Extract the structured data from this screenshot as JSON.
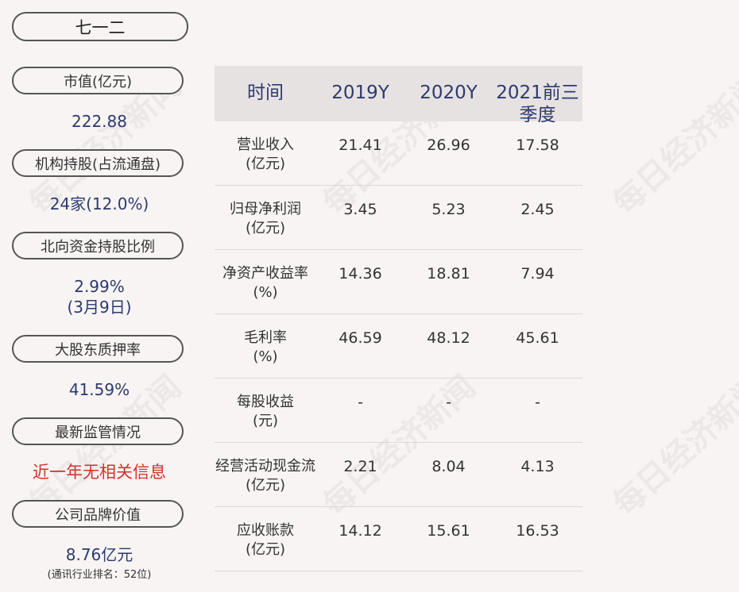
{
  "company": "七一二",
  "left_panel": [
    {
      "label": "市值(亿元)",
      "value": "222.88"
    },
    {
      "label": "机构持股(占流通盘)",
      "value": "24家(12.0%)"
    },
    {
      "label": "北向资金持股比例",
      "value": "2.99%",
      "value2": "(3月9日)"
    },
    {
      "label": "大股东质押率",
      "value": "41.59%"
    },
    {
      "label": "最新监管情况",
      "value": "近一年无相关信息"
    },
    {
      "label": "公司品牌价值",
      "value": "8.76亿元",
      "note": "(通讯行业排名：52位)"
    }
  ],
  "table": {
    "headers": [
      "时间",
      "2019Y",
      "2020Y",
      "2021前三季度"
    ],
    "rows": [
      {
        "label": "营业收入",
        "unit": "(亿元)",
        "values": [
          "21.41",
          "26.96",
          "17.58"
        ]
      },
      {
        "label": "归母净利润",
        "unit": "(亿元)",
        "values": [
          "3.45",
          "5.23",
          "2.45"
        ]
      },
      {
        "label": "净资产收益率",
        "unit": "(%)",
        "values": [
          "14.36",
          "18.81",
          "7.94"
        ]
      },
      {
        "label": "毛利率",
        "unit": "(%)",
        "values": [
          "46.59",
          "48.12",
          "45.61"
        ]
      },
      {
        "label": "每股收益",
        "unit": "(元)",
        "values": [
          "-",
          "-",
          "-"
        ]
      },
      {
        "label": "经营活动现金流",
        "unit": "(亿元)",
        "values": [
          "2.21",
          "8.04",
          "4.13"
        ]
      },
      {
        "label": "应收账款",
        "unit": "(亿元)",
        "values": [
          "14.12",
          "15.61",
          "16.53"
        ]
      }
    ]
  },
  "watermark": "每日经济新闻"
}
